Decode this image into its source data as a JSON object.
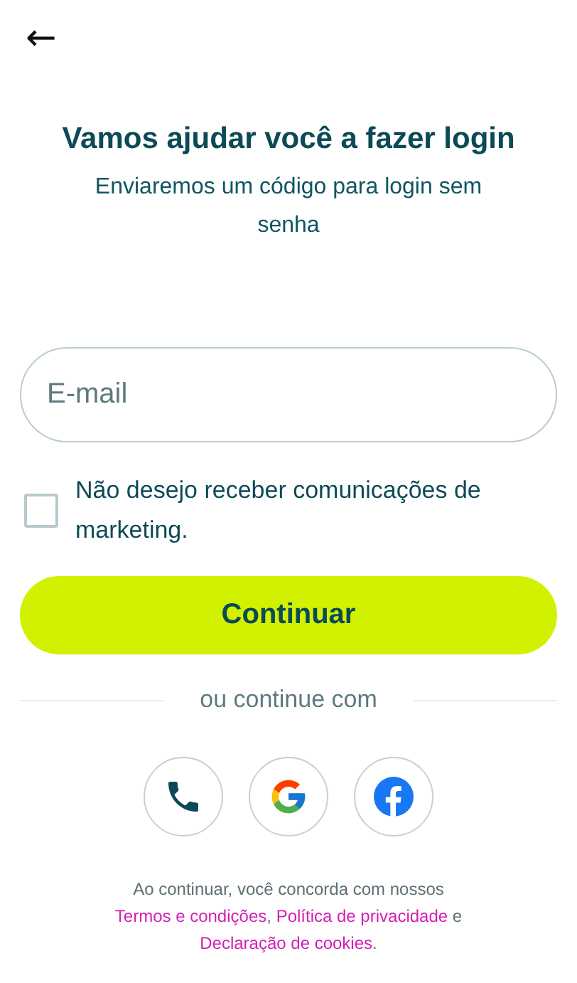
{
  "header": {
    "back": "←"
  },
  "title": "Vamos ajudar você a fazer login",
  "subtitle": "Enviaremos um código para login sem senha",
  "email": {
    "placeholder": "E-mail"
  },
  "marketing_opt_out": {
    "label": "Não desejo receber comunicações de marketing.",
    "checked": false
  },
  "primary_button": "Continuar",
  "divider": "ou continue com",
  "social_buttons": [
    {
      "kind": "phone"
    },
    {
      "kind": "google"
    },
    {
      "kind": "facebook"
    }
  ],
  "legal": [
    {
      "text": "Ao continuar, você concorda com nossos",
      "link": false
    },
    {
      "text": "Termos e condições",
      "link": true
    },
    {
      "text": ",",
      "link": false
    },
    {
      "text": "Política de privacidade",
      "link": true
    },
    {
      "text": "e",
      "link": false
    },
    {
      "text": "Declaração de cookies",
      "link": true
    },
    {
      "text": ".",
      "link": false
    }
  ]
}
